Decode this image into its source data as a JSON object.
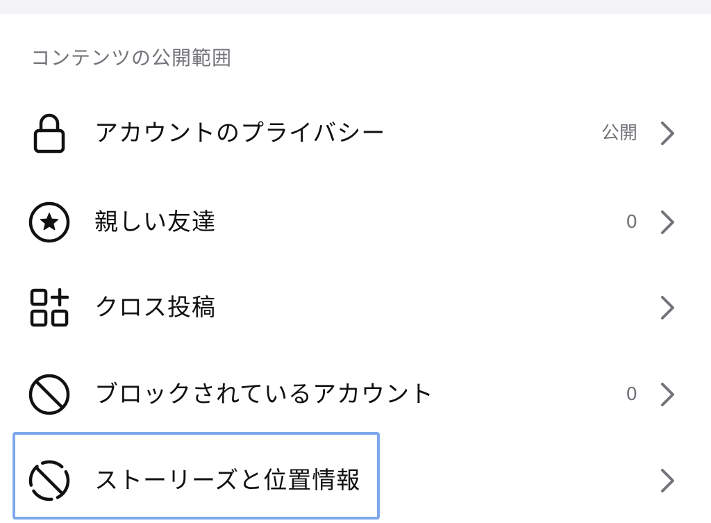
{
  "section": {
    "title": "コンテンツの公開範囲"
  },
  "rows": [
    {
      "icon": "lock-icon",
      "label": "アカウントのプライバシー",
      "value": "公開"
    },
    {
      "icon": "star-circle-icon",
      "label": "親しい友達",
      "value": "0"
    },
    {
      "icon": "grid-plus-icon",
      "label": "クロス投稿",
      "value": ""
    },
    {
      "icon": "block-icon",
      "label": "ブロックされているアカウント",
      "value": "0"
    },
    {
      "icon": "story-location-off-icon",
      "label": "ストーリーズと位置情報",
      "value": ""
    }
  ],
  "colors": {
    "text": "#111111",
    "secondary": "#73747a",
    "highlight": "#7ea7ec",
    "top_bar": "#f4f4f6"
  }
}
